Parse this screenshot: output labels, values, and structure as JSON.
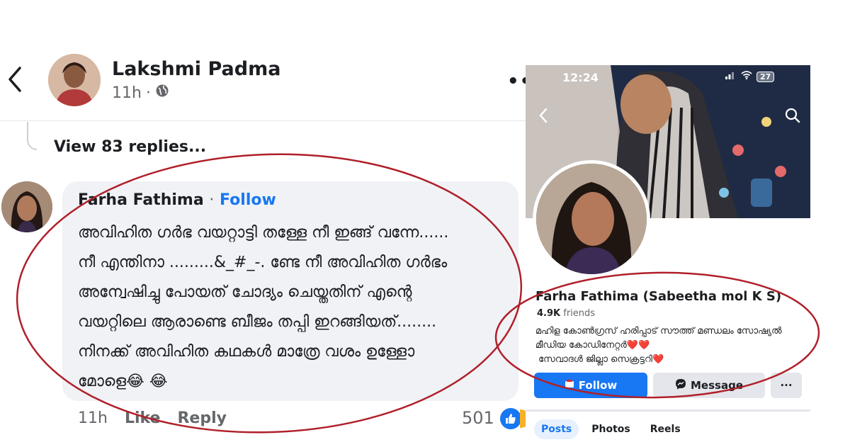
{
  "post": {
    "author": "Lakshmi Padma",
    "time": "11h",
    "more_icon": "more-dots-icon"
  },
  "thread": {
    "view_replies": "View 83 replies..."
  },
  "comment": {
    "author": "Farha Fathima",
    "separator": "·",
    "follow": "Follow",
    "lines": [
      "അവിഹിത  ഗർഭ വയറ്റാട്ടി തള്ളേ നീ ഇങ്ങ് വന്നേ......",
      "നീ എന്തിനാ .........&_#_-. ണ്ടേ നീ അവിഹിത ഗർഭം",
      "അന്വേഷിച്ചു പോയത് ചോദ്യം ചെയ്തതിന് എന്റെ",
      "വയറ്റിലെ ആരാണ്ടെ ബീജം തപ്പി ഇറങ്ങിയത്........",
      "നിനക്ക് അവിഹിത കഥകൾ മാത്രേ വശം ഉള്ളോ",
      "മോളെ😂 😂"
    ],
    "time": "11h",
    "like": "Like",
    "reply": "Reply",
    "reaction_count": "501"
  },
  "profile": {
    "status_time": "12:24",
    "battery": "27",
    "name": "Farha Fathima (Sabeetha mol K S)",
    "friends_count": "4.9K",
    "friends_label": "friends",
    "bio": [
      "മഹിള കോൺഗ്രസ് ഹരിപ്പാട് സൗത്ത് മണ്ഡലം സോഷ്യൽ",
      "മീഡിയ കോഡിനേറ്റർ",
      "സേവാദൾ ജില്ലാ സെക്രട്ടറി"
    ],
    "follow_button": "Follow",
    "message_button": "Message",
    "more_button": "···",
    "tabs": [
      {
        "label": "Posts",
        "active": true
      },
      {
        "label": "Photos",
        "active": false
      },
      {
        "label": "Reels",
        "active": false
      }
    ]
  },
  "colors": {
    "facebook_blue": "#1877f2",
    "annotation_red": "#b0202a",
    "bubble_bg": "#f0f2f5"
  }
}
